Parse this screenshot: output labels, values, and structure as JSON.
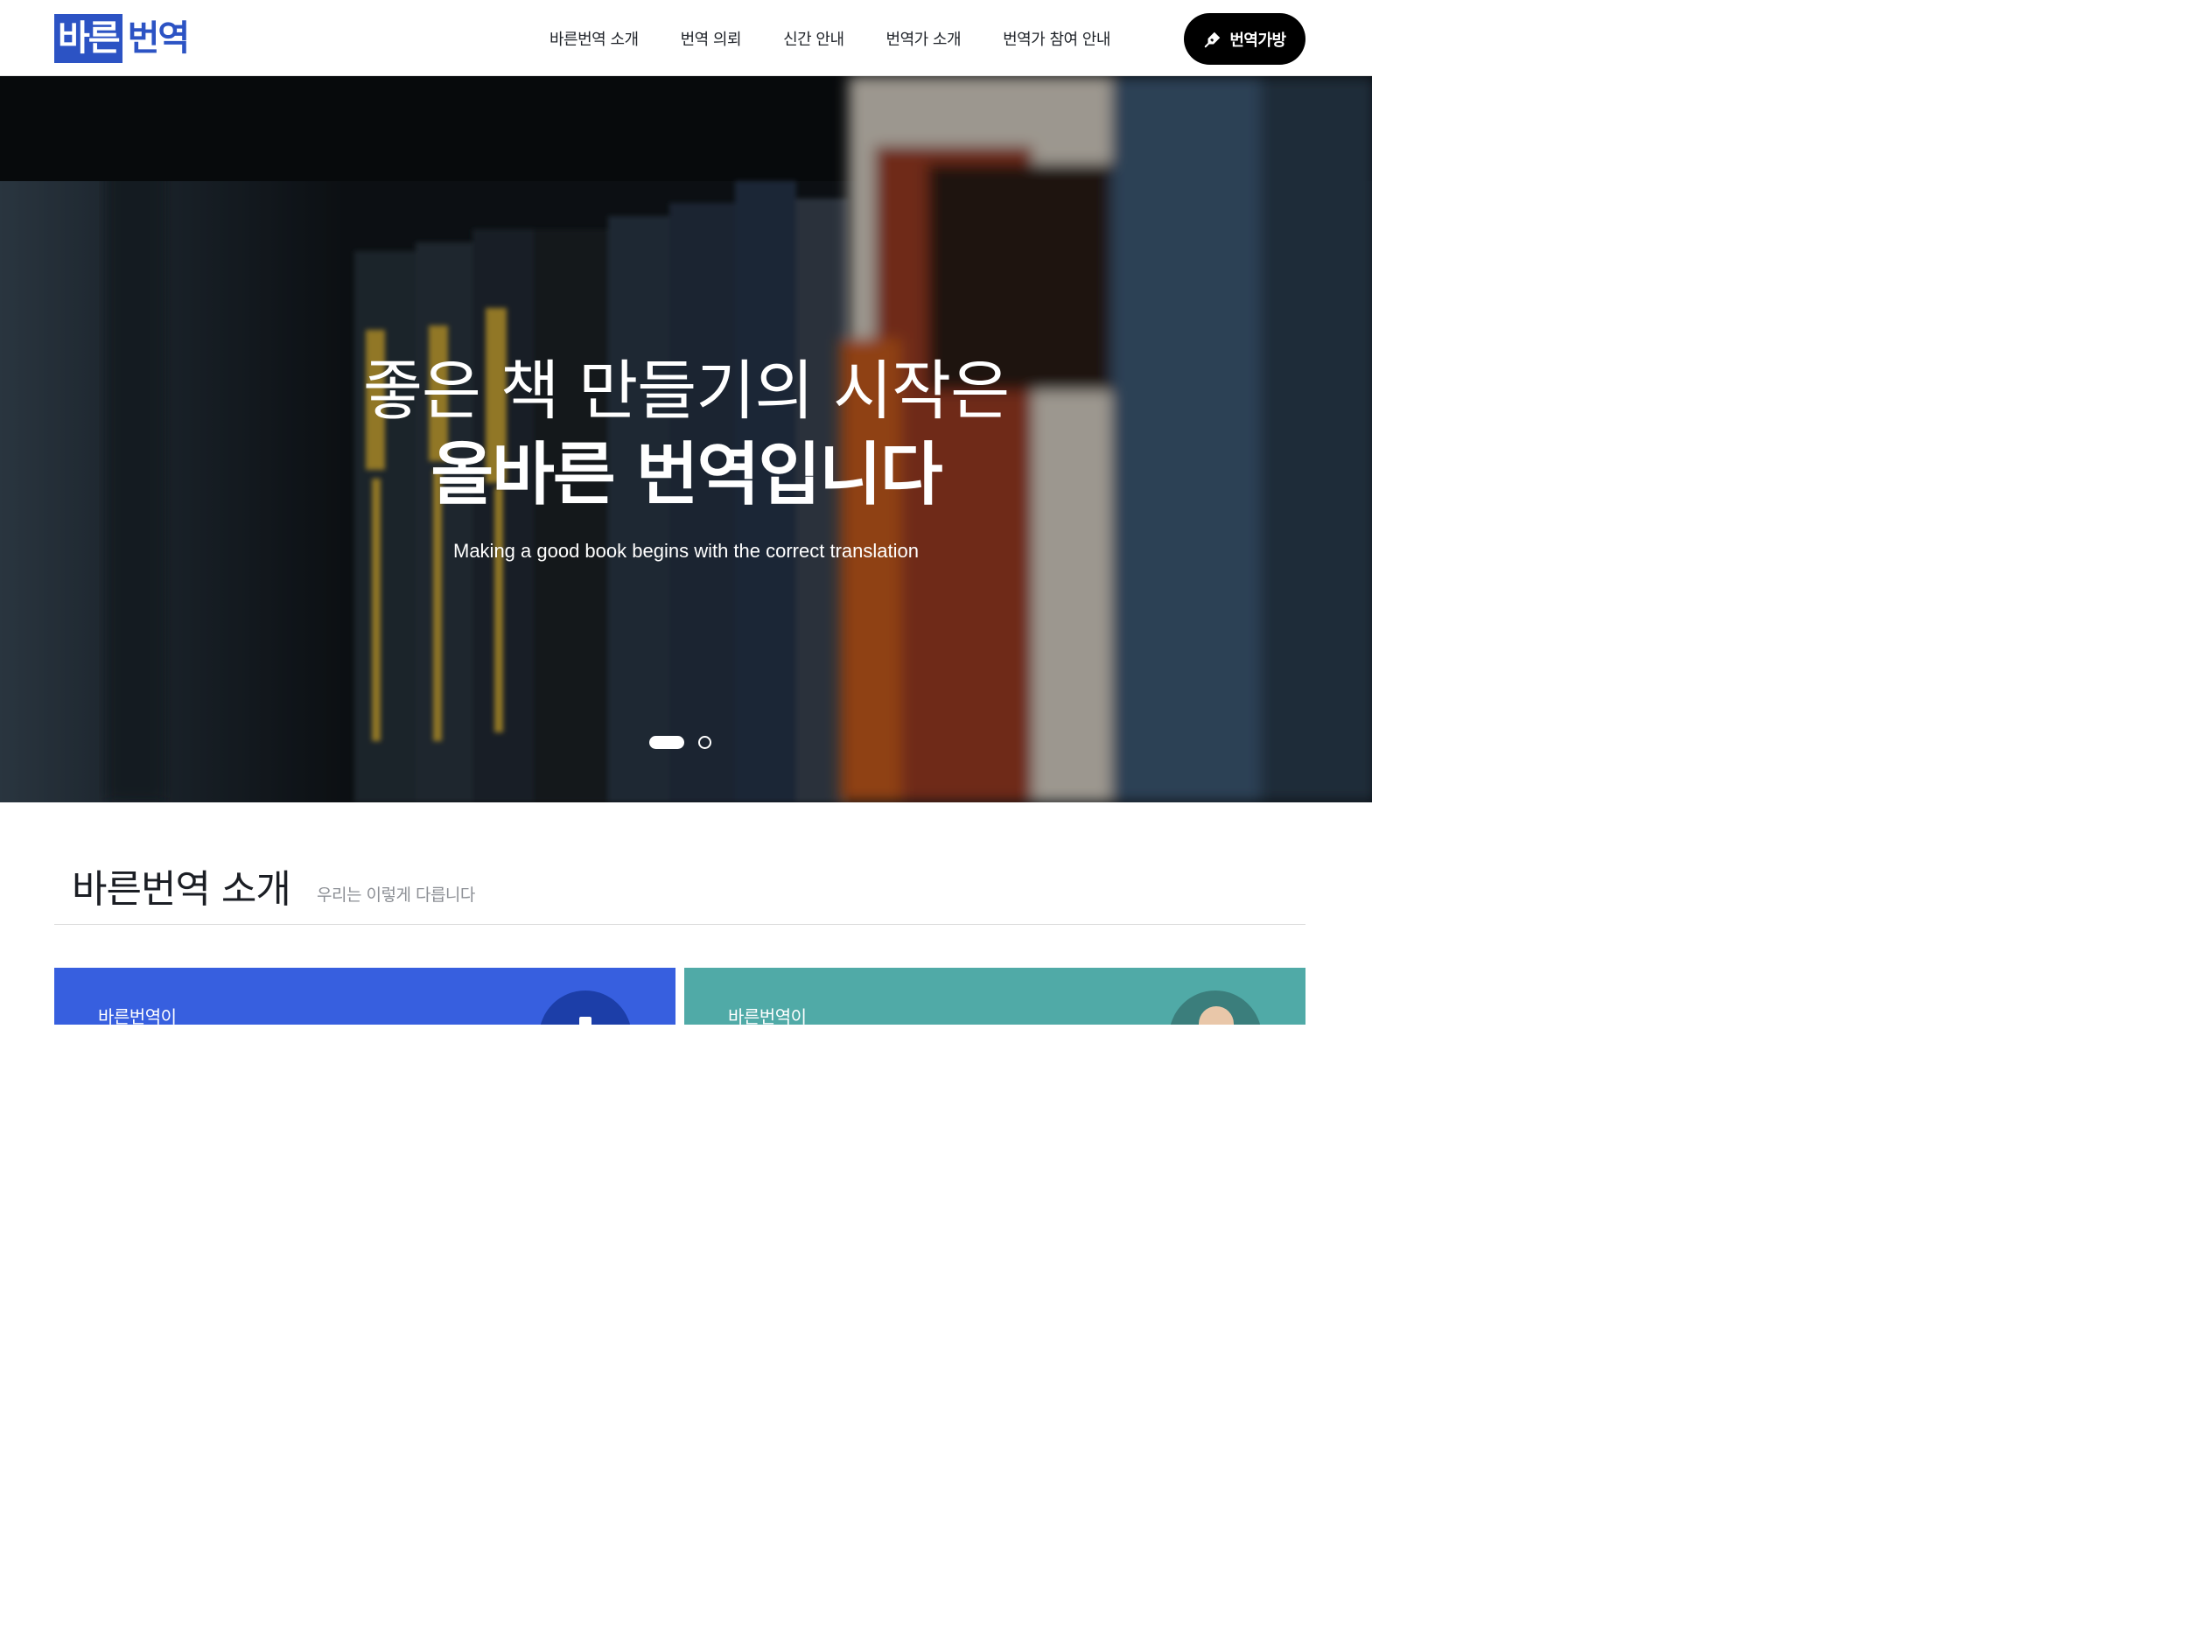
{
  "header": {
    "logo_part1": "바른",
    "logo_part2": "번역",
    "nav": [
      {
        "label": "바른번역 소개"
      },
      {
        "label": "번역 의뢰"
      },
      {
        "label": "신간 안내"
      },
      {
        "label": "번역가 소개"
      },
      {
        "label": "번역가 참여 안내"
      }
    ],
    "cta_label": "번역가방",
    "cta_icon": "pen-nib-icon"
  },
  "hero": {
    "line1": "좋은 책 만들기의 시작은",
    "line2": "올바른 번역입니다",
    "subtitle": "Making a good book begins with the correct translation",
    "slides_total": 2,
    "active_slide": 1
  },
  "intro": {
    "title": "바른번역 소개",
    "subtitle": "우리는 이렇게 다릅니다",
    "cards": [
      {
        "label": "바른번역이",
        "color": "#375fdf"
      },
      {
        "label": "바른번역이",
        "color": "#50aaa7"
      }
    ]
  },
  "colors": {
    "brand": "#2c53c4",
    "cta_bg": "#000000"
  }
}
